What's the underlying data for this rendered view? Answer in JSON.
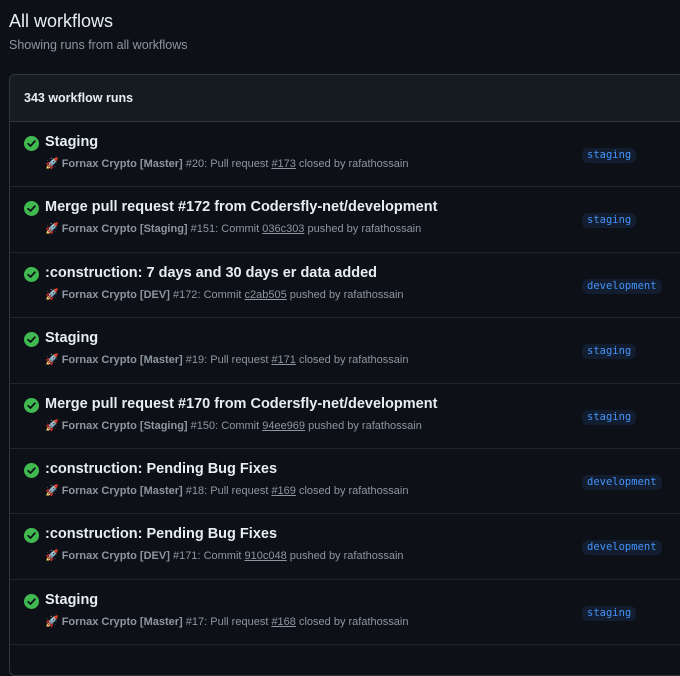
{
  "page": {
    "title": "All workflows",
    "subtitle": "Showing runs from all workflows"
  },
  "runs_header": {
    "count_label": "343 workflow runs"
  },
  "colors": {
    "success": "#3fb950",
    "branch_text": "#4493f8",
    "branch_bg": "#121d2f"
  },
  "runs": [
    {
      "status": "success",
      "status_icon": "check-circle-fill-icon",
      "title": "Staging",
      "rocket": "🚀",
      "workflow": "Fornax Crypto [Master]",
      "number": "#20",
      "event": "Pull request",
      "ref": "#173",
      "action": "closed by rafathossain",
      "branch": "staging"
    },
    {
      "status": "success",
      "status_icon": "check-circle-fill-icon",
      "title": "Merge pull request #172 from Codersfly-net/development",
      "rocket": "🚀",
      "workflow": "Fornax Crypto [Staging]",
      "number": "#151",
      "event": "Commit",
      "ref": "036c303",
      "action": "pushed by rafathossain",
      "branch": "staging"
    },
    {
      "status": "success",
      "status_icon": "check-circle-fill-icon",
      "title": ":construction: 7 days and 30 days er data added",
      "rocket": "🚀",
      "workflow": "Fornax Crypto [DEV]",
      "number": "#172",
      "event": "Commit",
      "ref": "c2ab505",
      "action": "pushed by rafathossain",
      "branch": "development"
    },
    {
      "status": "success",
      "status_icon": "check-circle-fill-icon",
      "title": "Staging",
      "rocket": "🚀",
      "workflow": "Fornax Crypto [Master]",
      "number": "#19",
      "event": "Pull request",
      "ref": "#171",
      "action": "closed by rafathossain",
      "branch": "staging"
    },
    {
      "status": "success",
      "status_icon": "check-circle-fill-icon",
      "title": "Merge pull request #170 from Codersfly-net/development",
      "rocket": "🚀",
      "workflow": "Fornax Crypto [Staging]",
      "number": "#150",
      "event": "Commit",
      "ref": "94ee969",
      "action": "pushed by rafathossain",
      "branch": "staging"
    },
    {
      "status": "success",
      "status_icon": "check-circle-fill-icon",
      "title": ":construction: Pending Bug Fixes",
      "rocket": "🚀",
      "workflow": "Fornax Crypto [Master]",
      "number": "#18",
      "event": "Pull request",
      "ref": "#169",
      "action": "closed by rafathossain",
      "branch": "development"
    },
    {
      "status": "success",
      "status_icon": "check-circle-fill-icon",
      "title": ":construction: Pending Bug Fixes",
      "rocket": "🚀",
      "workflow": "Fornax Crypto [DEV]",
      "number": "#171",
      "event": "Commit",
      "ref": "910c048",
      "action": "pushed by rafathossain",
      "branch": "development"
    },
    {
      "status": "success",
      "status_icon": "check-circle-fill-icon",
      "title": "Staging",
      "rocket": "🚀",
      "workflow": "Fornax Crypto [Master]",
      "number": "#17",
      "event": "Pull request",
      "ref": "#168",
      "action": "closed by rafathossain",
      "branch": "staging"
    }
  ]
}
